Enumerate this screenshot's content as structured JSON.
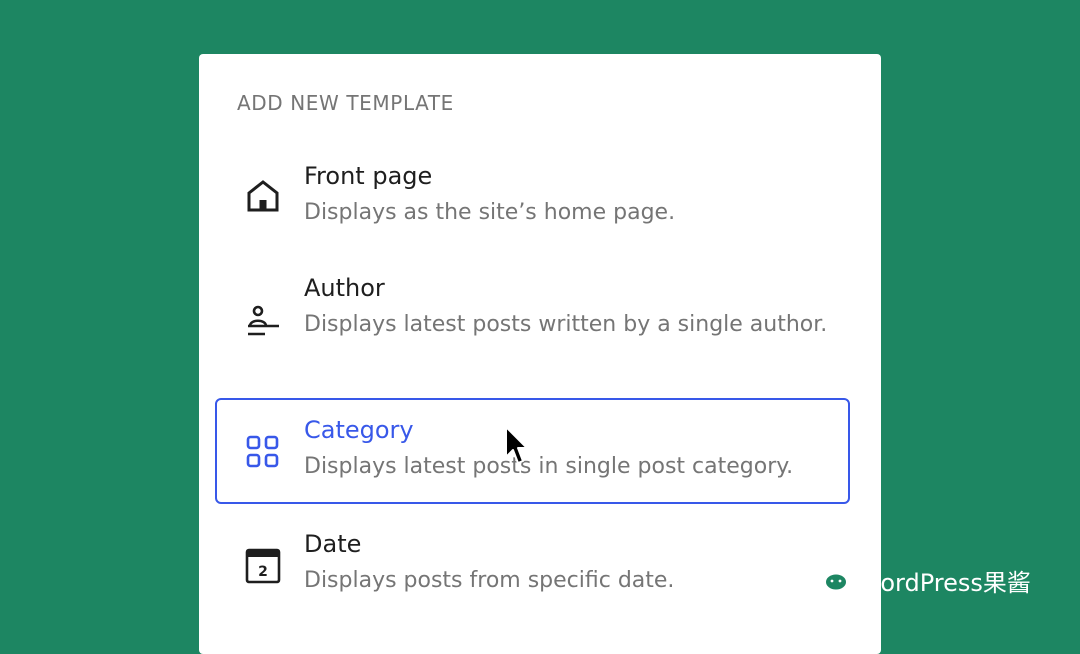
{
  "panel": {
    "title": "ADD NEW TEMPLATE",
    "items": [
      {
        "icon": "home-icon",
        "label": "Front page",
        "description": "Displays as the site’s home page.",
        "selected": false
      },
      {
        "icon": "author-icon",
        "label": "Author",
        "description": "Displays latest posts written by a single author.",
        "selected": false
      },
      {
        "icon": "category-grid-icon",
        "label": "Category",
        "description": "Displays latest posts in single post category.",
        "selected": true
      },
      {
        "icon": "calendar-icon",
        "label": "Date",
        "description": "Displays posts from specific date.",
        "calendar_number": "2",
        "selected": false
      }
    ]
  },
  "colors": {
    "background": "#1d8662",
    "accent": "#3858e9",
    "label": "#1e1e1e",
    "muted": "#757575"
  },
  "watermark": {
    "icon": "wechat-icon",
    "text": "WordPress果酱"
  }
}
